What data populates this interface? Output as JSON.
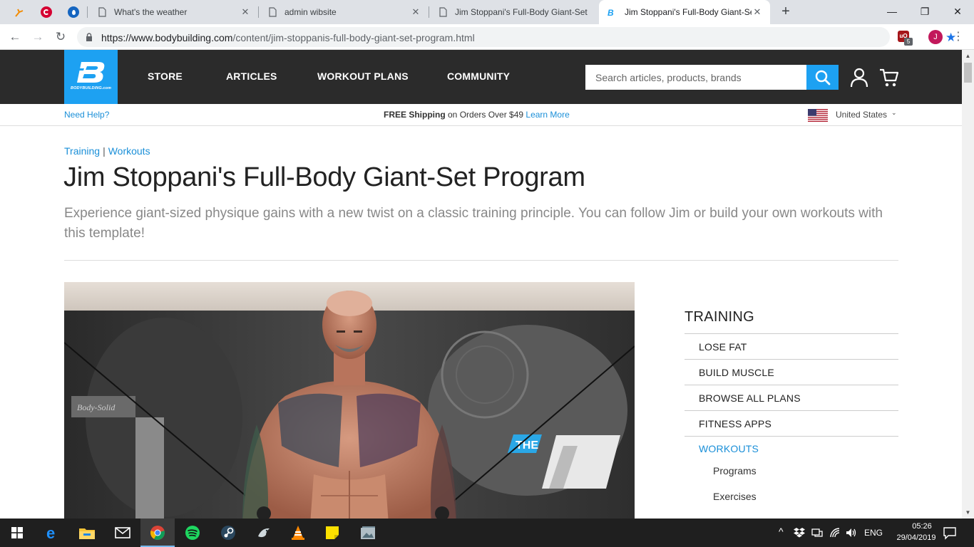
{
  "browser": {
    "tabs": [
      {
        "title": "What's the weather"
      },
      {
        "title": "admin wibsite"
      },
      {
        "title": "Jim Stoppani's Full-Body Giant-Set"
      },
      {
        "title": "Jim Stoppani's Full-Body Giant-Set"
      }
    ],
    "new_tab": "+",
    "url_host": "https://www.bodybuilding.com",
    "url_path": "/content/jim-stoppanis-full-body-giant-set-program.html",
    "extension_badge": "5",
    "profile_initial": "J"
  },
  "site": {
    "logo_text": "BODYBUILDING.com",
    "nav": [
      "STORE",
      "ARTICLES",
      "WORKOUT PLANS",
      "COMMUNITY"
    ],
    "search_placeholder": "Search articles, products, brands",
    "need_help": "Need Help?",
    "promo_bold": "FREE Shipping",
    "promo_text": " on Orders Over $49 ",
    "promo_link": "Learn More",
    "region": "United States"
  },
  "article": {
    "breadcrumb": [
      "Training",
      "Workouts"
    ],
    "title": "Jim Stoppani's Full-Body Giant-Set Program",
    "subtitle": "Experience giant-sized physique gains with a new twist on a classic training principle. You can follow Jim or build your own workouts with this template!"
  },
  "sidebar": {
    "heading": "TRAINING",
    "items": [
      "LOSE FAT",
      "BUILD MUSCLE",
      "BROWSE ALL PLANS",
      "FITNESS APPS",
      "WORKOUTS"
    ],
    "subitems": [
      "Programs",
      "Exercises"
    ]
  },
  "taskbar": {
    "language": "ENG",
    "time": "05:26",
    "date": "29/04/2019"
  },
  "colors": {
    "brand_blue": "#1da1f2",
    "link_blue": "#1a8fd8",
    "nav_dark": "#2b2b2b"
  }
}
